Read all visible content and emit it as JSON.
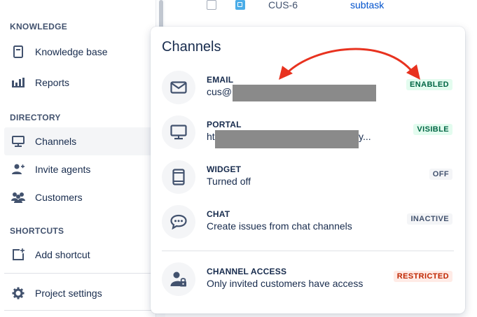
{
  "sidebar": {
    "sections": [
      {
        "title": "KNOWLEDGE"
      },
      {
        "title": "DIRECTORY"
      },
      {
        "title": "SHORTCUTS"
      }
    ],
    "items": [
      {
        "label": "Knowledge base",
        "icon": "book-icon"
      },
      {
        "label": "Reports",
        "icon": "bar-chart-icon"
      },
      {
        "label": "Channels",
        "icon": "monitor-icon",
        "active": true
      },
      {
        "label": "Invite agents",
        "icon": "add-person-icon"
      },
      {
        "label": "Customers",
        "icon": "people-icon"
      },
      {
        "label": "Add shortcut",
        "icon": "add-shortcut-icon"
      },
      {
        "label": "Project settings",
        "icon": "gear-icon"
      }
    ]
  },
  "background_row": {
    "key": "CUS-6",
    "type": "subtask"
  },
  "popup": {
    "title": "Channels",
    "channels": [
      {
        "name": "EMAIL",
        "desc": "cus@",
        "badge": "ENABLED",
        "icon": "envelope-icon"
      },
      {
        "name": "PORTAL",
        "desc": "ht",
        "desc_tail": "y...",
        "badge": "VISIBLE",
        "icon": "monitor-icon"
      },
      {
        "name": "WIDGET",
        "desc": "Turned off",
        "badge": "OFF",
        "icon": "widget-icon"
      },
      {
        "name": "CHAT",
        "desc": "Create issues from chat channels",
        "badge": "INACTIVE",
        "icon": "chat-bubble-icon"
      },
      {
        "name": "CHANNEL ACCESS",
        "desc": "Only invited customers have access",
        "badge": "RESTRICTED",
        "icon": "person-lock-icon"
      }
    ]
  },
  "colors": {
    "annotation_arrow": "#e8321f",
    "badge_green_bg": "#e3fcef",
    "badge_green_text": "#006644",
    "badge_red_bg": "#ffebe6",
    "badge_red_text": "#bf2600",
    "link": "#0052cc"
  }
}
